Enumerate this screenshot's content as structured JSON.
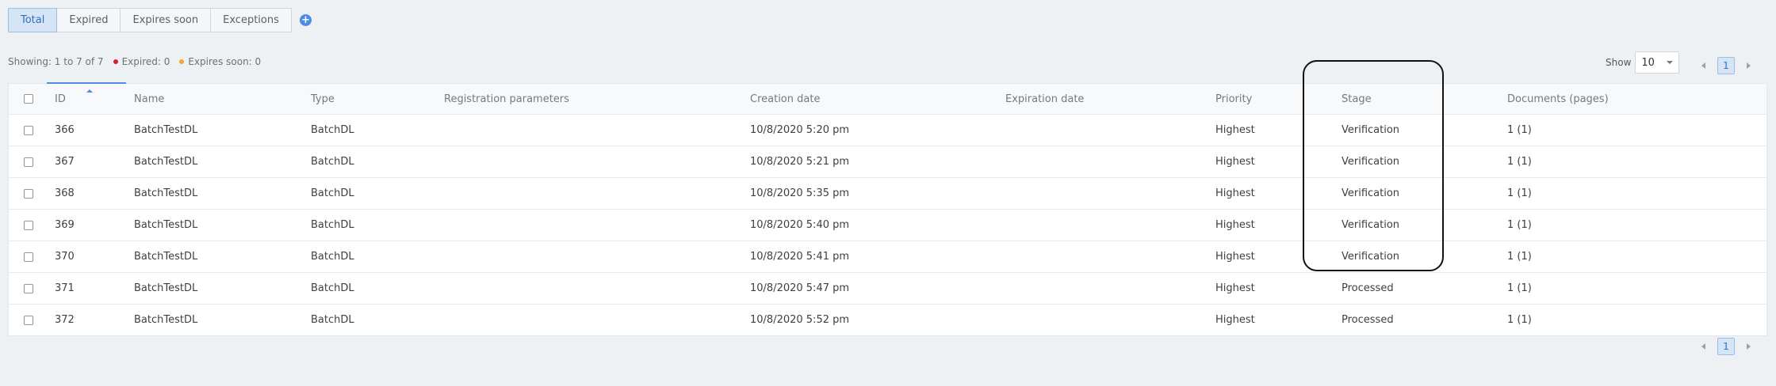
{
  "tabs": [
    {
      "label": "Total",
      "active": true
    },
    {
      "label": "Expired",
      "active": false
    },
    {
      "label": "Expires soon",
      "active": false
    },
    {
      "label": "Exceptions",
      "active": false
    }
  ],
  "add_tab_icon": "+",
  "status": {
    "showing": "Showing: 1 to 7 of 7",
    "expired": "Expired: 0",
    "expires_soon": "Expires soon: 0"
  },
  "colors": {
    "expired": "#d4202a",
    "expires_soon": "#f5a623",
    "accent": "#4a8ce6"
  },
  "show": {
    "label": "Show",
    "value": "10"
  },
  "pager": {
    "current_page": "1"
  },
  "table": {
    "headers": {
      "id": "ID",
      "name": "Name",
      "type": "Type",
      "registration": "Registration parameters",
      "created": "Creation date",
      "expiration": "Expiration date",
      "priority": "Priority",
      "stage": "Stage",
      "documents": "Documents (pages)"
    },
    "rows": [
      {
        "id": "366",
        "name": "BatchTestDL",
        "type": "BatchDL",
        "registration": "",
        "created": "10/8/2020 5:20 pm",
        "expiration": "",
        "priority": "Highest",
        "stage": "Verification",
        "documents": "1 (1)"
      },
      {
        "id": "367",
        "name": "BatchTestDL",
        "type": "BatchDL",
        "registration": "",
        "created": "10/8/2020 5:21 pm",
        "expiration": "",
        "priority": "Highest",
        "stage": "Verification",
        "documents": "1 (1)"
      },
      {
        "id": "368",
        "name": "BatchTestDL",
        "type": "BatchDL",
        "registration": "",
        "created": "10/8/2020 5:35 pm",
        "expiration": "",
        "priority": "Highest",
        "stage": "Verification",
        "documents": "1 (1)"
      },
      {
        "id": "369",
        "name": "BatchTestDL",
        "type": "BatchDL",
        "registration": "",
        "created": "10/8/2020 5:40 pm",
        "expiration": "",
        "priority": "Highest",
        "stage": "Verification",
        "documents": "1 (1)"
      },
      {
        "id": "370",
        "name": "BatchTestDL",
        "type": "BatchDL",
        "registration": "",
        "created": "10/8/2020 5:41 pm",
        "expiration": "",
        "priority": "Highest",
        "stage": "Verification",
        "documents": "1 (1)"
      },
      {
        "id": "371",
        "name": "BatchTestDL",
        "type": "BatchDL",
        "registration": "",
        "created": "10/8/2020 5:47 pm",
        "expiration": "",
        "priority": "Highest",
        "stage": "Processed",
        "documents": "1 (1)"
      },
      {
        "id": "372",
        "name": "BatchTestDL",
        "type": "BatchDL",
        "registration": "",
        "created": "10/8/2020 5:52 pm",
        "expiration": "",
        "priority": "Highest",
        "stage": "Processed",
        "documents": "1 (1)"
      }
    ]
  }
}
